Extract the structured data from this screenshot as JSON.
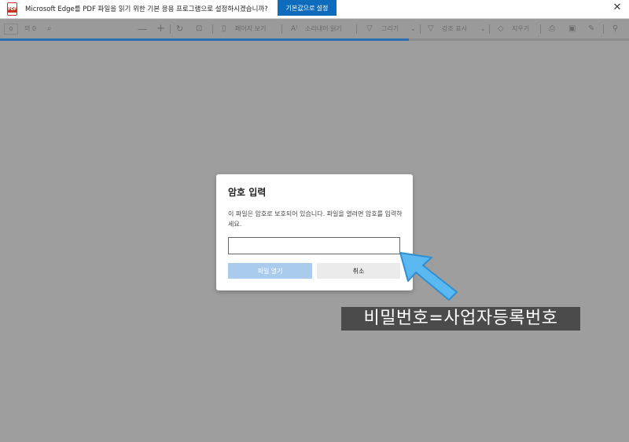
{
  "notification": {
    "message": "Microsoft Edge를 PDF 파일을 읽기 위한 기본 응용 프로그램으로 설정하시겠습니까?",
    "set_default_label": "기본값으로 설정",
    "close_icon": "close-icon"
  },
  "toolbar": {
    "page_number": "0",
    "page_total": "의 0",
    "page_view_label": "페이지 보기",
    "read_aloud_label": "소리내어 읽기",
    "draw_label": "그리기",
    "highlight_label": "강조 표시",
    "erase_label": "지우기",
    "icons": [
      "search-icon",
      "zoom-out-icon",
      "zoom-in-icon",
      "rotate-icon",
      "fit-page-icon",
      "page-view-icon",
      "read-aloud-icon",
      "draw-icon",
      "highlight-icon",
      "eraser-icon",
      "print-icon",
      "save-icon",
      "save-as-icon",
      "pin-icon"
    ]
  },
  "dialog": {
    "title": "암호 입력",
    "message": "이 파일은 암호로 보호되어 있습니다. 파일을 열려면 암호를 입력하세요.",
    "password_value": "",
    "open_label": "파일 열기",
    "cancel_label": "취소"
  },
  "annotation": {
    "text": "비밀번호=사업자등록번호",
    "arrow_color": "#5bb8f0"
  },
  "colors": {
    "accent": "#0f6cbd",
    "progress": "#2a6fb0",
    "backdrop": "#9e9e9e"
  }
}
